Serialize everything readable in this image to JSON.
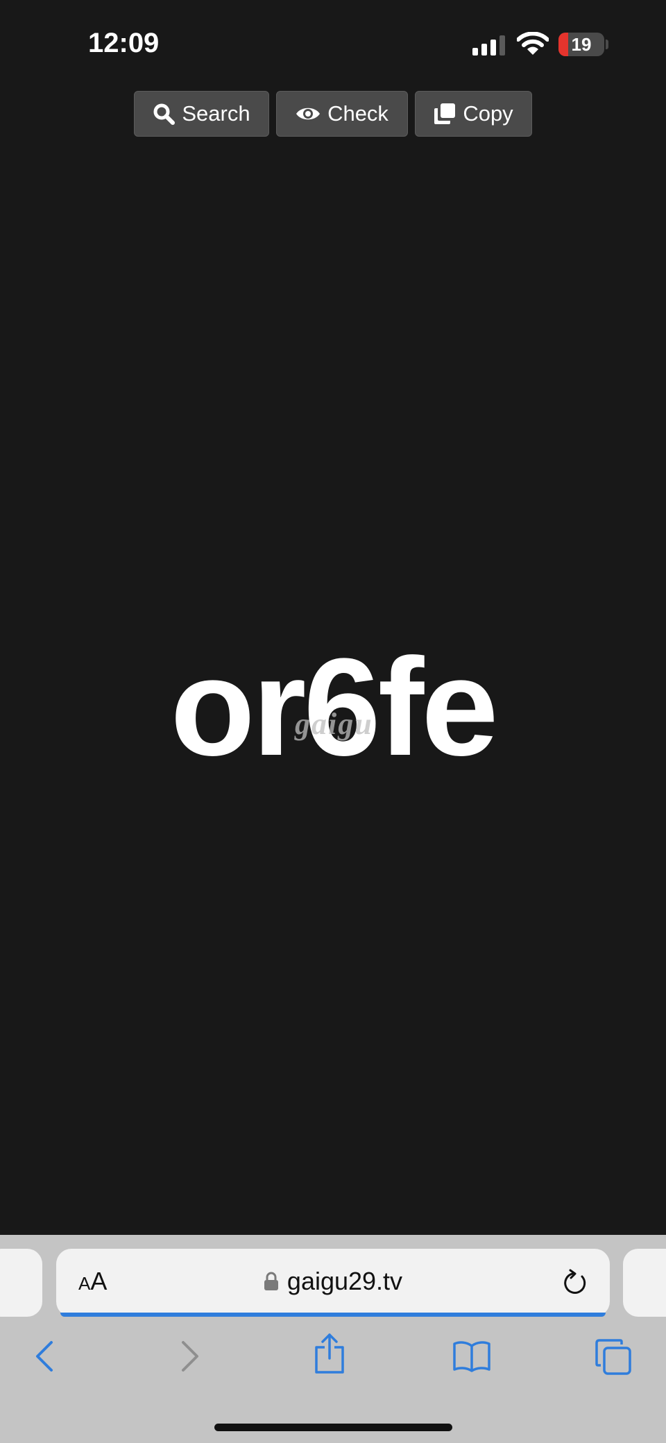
{
  "status_bar": {
    "time": "12:09",
    "battery_level": "19",
    "icons": [
      "signal-icon",
      "wifi-icon",
      "battery-icon"
    ]
  },
  "toolbar": {
    "search_label": "Search",
    "check_label": "Check",
    "copy_label": "Copy",
    "icons": [
      "search-icon",
      "eye-icon",
      "copy-icon"
    ]
  },
  "content": {
    "code": "or6fe",
    "watermark": "gaigu"
  },
  "browser": {
    "aa_small": "A",
    "aa_big": "A",
    "url": "gaigu29.tv",
    "icons": [
      "lock-icon",
      "reload-icon",
      "back-icon",
      "forward-icon",
      "share-icon",
      "bookmarks-icon",
      "tabs-icon"
    ],
    "accent_color": "#2f7ddc"
  }
}
